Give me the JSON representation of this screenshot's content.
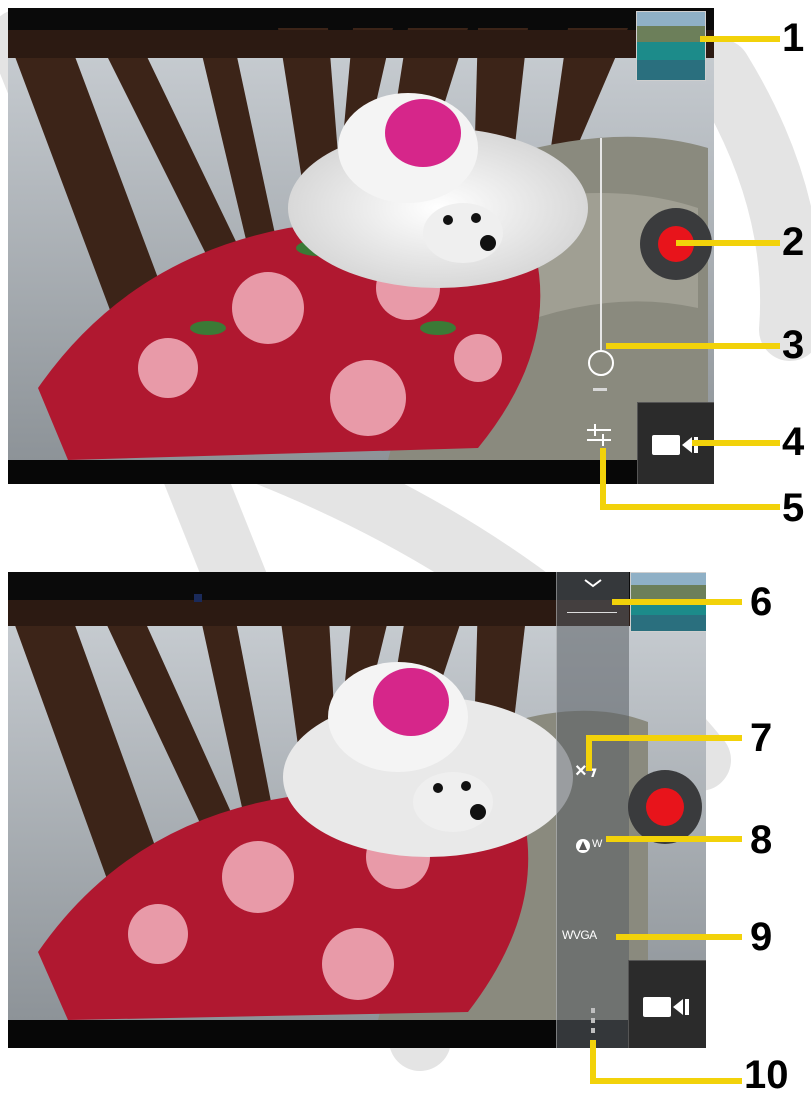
{
  "figure": {
    "callouts": [
      "1",
      "2",
      "3",
      "4",
      "5",
      "6",
      "7",
      "8",
      "9",
      "10"
    ]
  },
  "screen2": {
    "menu": {
      "flash_icon": "×ϟ",
      "white_balance_label": "W",
      "resolution_label": "WVGA"
    }
  },
  "colors": {
    "record": "#e8141b",
    "callout_line": "#f2d20a",
    "panel_background": "#2b2b2b"
  },
  "icons": {
    "gallery_thumbnail": "gallery-thumbnail-icon",
    "record": "record-button",
    "zoom_slider": "zoom-slider",
    "camera_switch": "video-camera-icon",
    "settings": "settings-sliders-icon",
    "collapse": "chevron-down-icon",
    "flash": "flash-off-icon",
    "white_balance": "white-balance-auto-icon",
    "more": "more-vertical-icon"
  }
}
